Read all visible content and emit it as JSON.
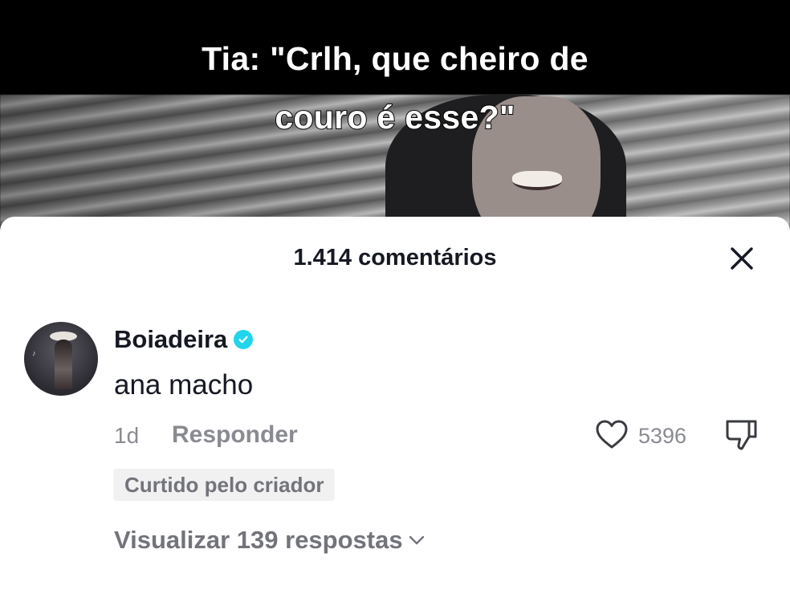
{
  "video": {
    "caption_line1": "Tia: \"Crlh, que cheiro de",
    "caption_line2": "couro é esse?\""
  },
  "comments_sheet": {
    "title": "1.414 comentários",
    "close_icon": "close-icon"
  },
  "comment": {
    "username": "Boiadeira",
    "verified_icon": "verified-badge-icon",
    "text": "ana macho",
    "age": "1d",
    "reply_label": "Responder",
    "like_icon": "heart-outline-icon",
    "like_count": "5396",
    "dislike_icon": "thumbs-down-icon",
    "creator_badge": "Curtido pelo criador",
    "view_replies_label": "Visualizar 139 respostas",
    "view_replies_icon": "chevron-down-icon"
  },
  "colors": {
    "primary_text": "#161823",
    "secondary_text": "#8a8b91",
    "verified_accent": "#20d5ec",
    "badge_background": "#f1f1f2"
  }
}
